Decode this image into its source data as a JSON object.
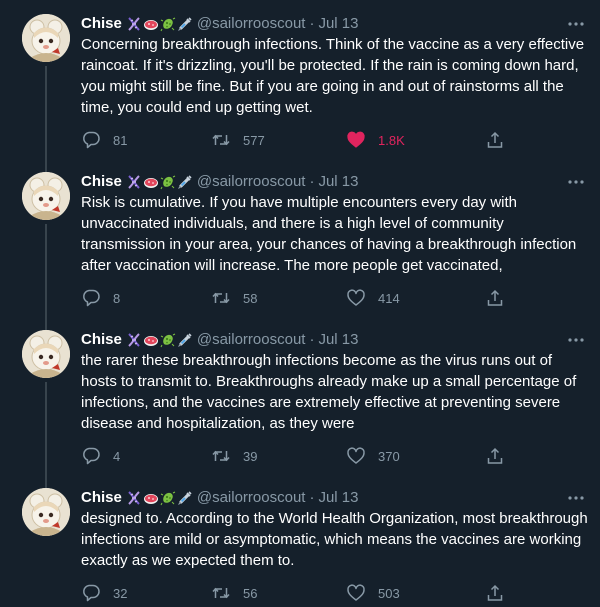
{
  "colors": {
    "background": "#15202b",
    "text": "#ffffff",
    "muted": "#8899a6",
    "like_active": "#e0245e",
    "divider": "#38444d"
  },
  "tweets": [
    {
      "name": "Chise",
      "handle": "@sailorrooscout",
      "dot": "·",
      "date": "Jul 13",
      "text": "Concerning breakthrough infections. Think of the vaccine as a very effective raincoat. If it's drizzling, you'll be protected. If the rain is coming down hard, you might still be fine. But if you are going in and out of rainstorms all the time, you could end up getting wet.",
      "replies": "81",
      "retweets": "577",
      "likes": "1.8K",
      "liked": true
    },
    {
      "name": "Chise",
      "handle": "@sailorrooscout",
      "dot": "·",
      "date": "Jul 13",
      "text": "Risk is cumulative. If you have multiple encounters every day with unvaccinated individuals, and there is a high level of community transmission in your area, your chances of having a breakthrough infection after vaccination will increase. The more people get vaccinated,",
      "replies": "8",
      "retweets": "58",
      "likes": "414",
      "liked": false
    },
    {
      "name": "Chise",
      "handle": "@sailorrooscout",
      "dot": "·",
      "date": "Jul 13",
      "text": "the rarer these breakthrough infections become as the virus runs out of hosts to transmit to. Breakthroughs already make up a small percentage of infections, and the vaccines are extremely effective at preventing severe disease and hospitalization, as they were",
      "replies": "4",
      "retweets": "39",
      "likes": "370",
      "liked": false
    },
    {
      "name": "Chise",
      "handle": "@sailorrooscout",
      "dot": "·",
      "date": "Jul 13",
      "text": "designed to. According to the World Health Organization, most breakthrough infections are mild or asymptomatic, which means the vaccines are working exactly as we expected them to.",
      "replies": "32",
      "retweets": "56",
      "likes": "503",
      "liked": false
    }
  ],
  "icons": {
    "name_emojis": [
      "dna-icon",
      "petri-dish-icon",
      "microbe-icon",
      "syringe-icon"
    ],
    "reply": "reply-icon",
    "retweet": "retweet-icon",
    "like": "heart-icon",
    "share": "share-icon",
    "more": "more-icon"
  }
}
